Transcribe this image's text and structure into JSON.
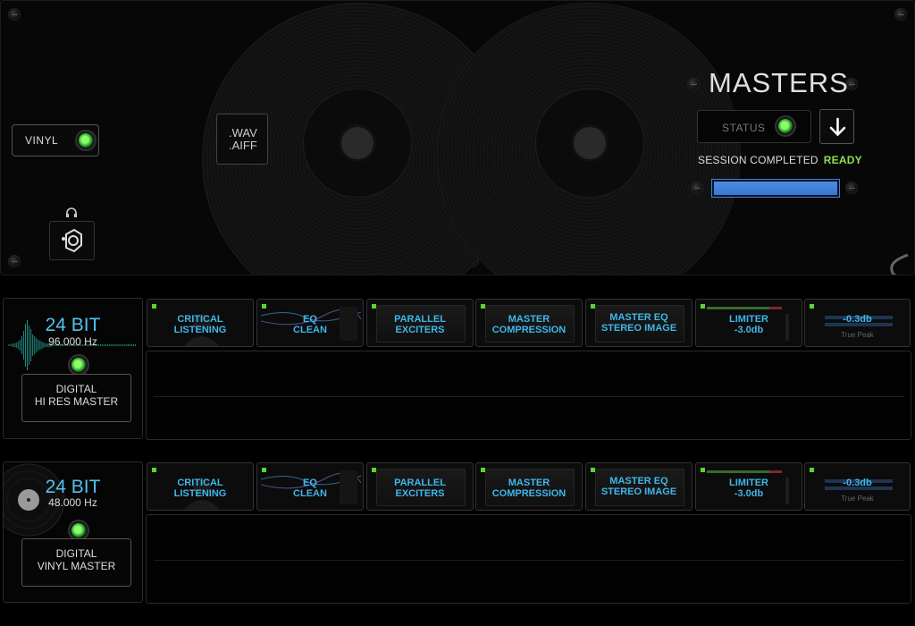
{
  "top": {
    "vinyl_label": "VINYL",
    "formats": [
      ".WAV",
      ".AIFF"
    ],
    "title": "MASTERS",
    "status_label": "STATUS",
    "session_text": "SESSION COMPLETED",
    "ready_text": "READY",
    "progress": 1.0,
    "icons": {
      "headphones": "headphones-icon",
      "mastering": "mastering-tool-icon",
      "download": "download-arrow-icon"
    }
  },
  "colors": {
    "accent": "#4fc3ee",
    "led_green": "#5cd430",
    "ready_green": "#8ee04a",
    "progress_blue": "#4b8ce0"
  },
  "chains": [
    {
      "bit_depth": "24 BIT",
      "sample_rate": "96.000 Hz",
      "source_line1": "DIGITAL",
      "source_line2": "HI RES MASTER",
      "modules": [
        {
          "line1": "CRITICAL",
          "line2": "LISTENING",
          "sub": ""
        },
        {
          "line1": "EQ",
          "line2": "CLEAN",
          "sub": ""
        },
        {
          "line1": "PARALLEL",
          "line2": "EXCITERS",
          "sub": ""
        },
        {
          "line1": "MASTER",
          "line2": "COMPRESSION",
          "sub": ""
        },
        {
          "line1": "MASTER EQ",
          "line2": "STEREO IMAGE",
          "sub": ""
        },
        {
          "line1": "LIMITER",
          "line2": "-3.0db",
          "sub": ""
        },
        {
          "line1": "-0.3db",
          "line2": "",
          "sub": "True Peak"
        }
      ]
    },
    {
      "bit_depth": "24 BIT",
      "sample_rate": "48.000 Hz",
      "source_line1": "DIGITAL",
      "source_line2": "VINYL MASTER",
      "modules": [
        {
          "line1": "CRITICAL",
          "line2": "LISTENING",
          "sub": ""
        },
        {
          "line1": "EQ",
          "line2": "CLEAN",
          "sub": ""
        },
        {
          "line1": "PARALLEL",
          "line2": "EXCITERS",
          "sub": ""
        },
        {
          "line1": "MASTER",
          "line2": "COMPRESSION",
          "sub": ""
        },
        {
          "line1": "MASTER EQ",
          "line2": "STEREO IMAGE",
          "sub": ""
        },
        {
          "line1": "LIMITER",
          "line2": "-3.0db",
          "sub": ""
        },
        {
          "line1": "-0.3db",
          "line2": "",
          "sub": "True Peak"
        }
      ]
    }
  ]
}
